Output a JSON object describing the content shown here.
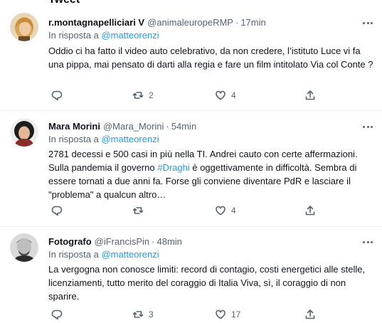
{
  "header": {
    "title": "Tweet"
  },
  "reply_prefix": "In risposta a",
  "tweets": [
    {
      "name": "r.montagnapelliciari V",
      "handle": "@animaleuropeRMP",
      "dot": "·",
      "time": "17min",
      "reply_to": "@matteorenzi",
      "text": "Oddio ci ha fatto il video auto celebrativo, da non credere, l’istituto Luce vi fa una pippa, mai pensato di darti alla regia e fare un film intitolato Via col Conte ?",
      "replies": "",
      "retweets": "2",
      "likes": "4"
    },
    {
      "name": "Mara Morini",
      "handle": "@Mara_Morini",
      "dot": "·",
      "time": "54min",
      "reply_to": "@matteorenzi",
      "text_a": "2781 decessi e 500 casi in più nella TI. Andrei cauto con certe affermazioni. Sulla pandemia il governo ",
      "hashtag": "#Draghi",
      "text_b": " è oggettivamente in difficoltà. Sembra di essere tornati a due anni fa. Forse gli conviene diventare PdR e lasciare il \"problema\" a qualcun altro…",
      "replies": "",
      "retweets": "",
      "likes": "4"
    },
    {
      "name": "Fotografo",
      "handle": "@iFrancisPin",
      "dot": "·",
      "time": "48min",
      "reply_to": "@matteorenzi",
      "text": "La vergogna non conosce limiti: record di contagio, costi energetici alle stelle, licenziamenti, tutto merito del coraggio di Italia Viva, sì, il coraggio di non sparire.",
      "replies": "",
      "retweets": "3",
      "likes": "17"
    }
  ],
  "icons": {
    "reply": "reply-icon",
    "retweet": "retweet-icon",
    "like": "heart-icon",
    "share": "share-icon",
    "more": "more-icon"
  },
  "colors": {
    "accent": "#1d9bf0",
    "text": "#0f1419",
    "secondary": "#536471",
    "divider": "#eff3f4"
  }
}
